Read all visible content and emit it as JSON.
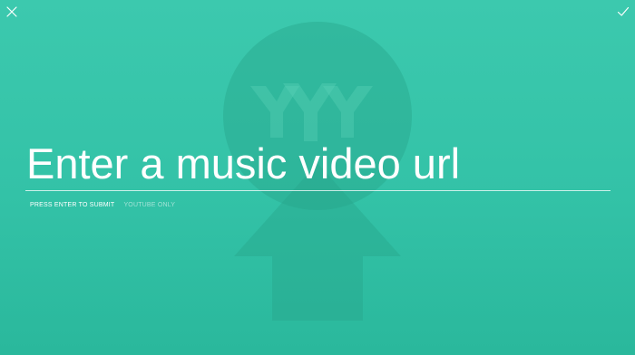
{
  "input": {
    "placeholder": "Enter a music video url",
    "value": ""
  },
  "hints": {
    "submit": "PRESS ENTER TO SUBMIT",
    "source": "YOUTUBE ONLY"
  },
  "icons": {
    "close": "close-icon",
    "confirm": "checkmark-icon",
    "background": "yyy-logo-upload-arrow"
  },
  "colors": {
    "background_top": "#3cc9ae",
    "background_bottom": "#2ab89c",
    "watermark": "#2fae94",
    "text": "#ffffff"
  }
}
